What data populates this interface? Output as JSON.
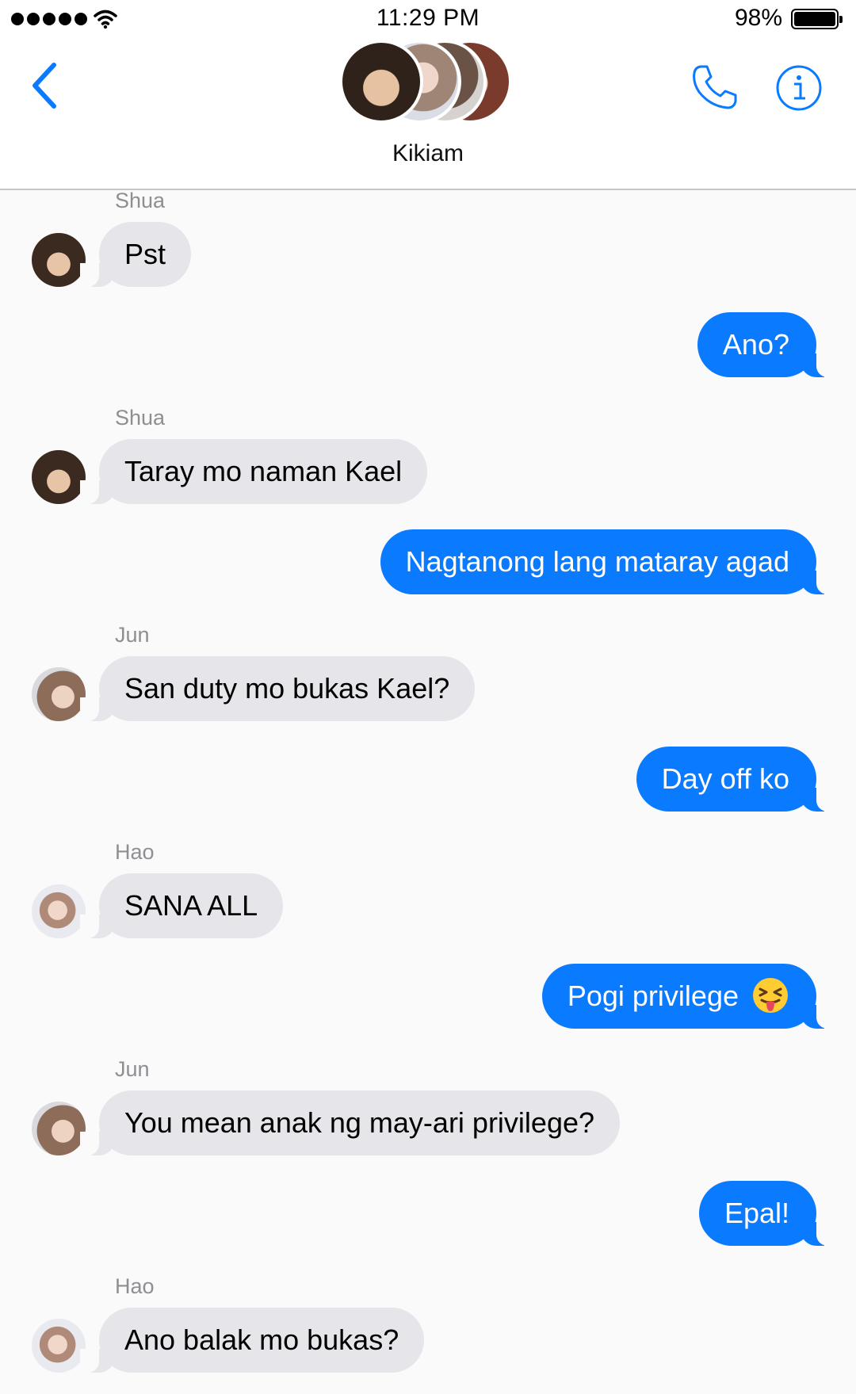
{
  "status_bar": {
    "time": "11:29 PM",
    "battery": "98%",
    "icons": [
      "signal-dots-icon",
      "wifi-icon",
      "battery-icon"
    ]
  },
  "header": {
    "group_name": "Kikiam",
    "icons": [
      "chevron-left-icon",
      "phone-icon",
      "info-icon"
    ],
    "accent_color": "#0a7aff"
  },
  "messages": [
    {
      "sender": "Shua",
      "text": "Pst",
      "direction": "incoming"
    },
    {
      "text": "Ano?",
      "direction": "outgoing"
    },
    {
      "sender": "Shua",
      "text": "Taray mo naman Kael",
      "direction": "incoming"
    },
    {
      "text": "Nagtanong lang mataray agad",
      "direction": "outgoing"
    },
    {
      "sender": "Jun",
      "text": "San duty mo bukas Kael?",
      "direction": "incoming"
    },
    {
      "text": "Day off ko",
      "direction": "outgoing"
    },
    {
      "sender": "Hao",
      "text": "SANA ALL",
      "direction": "incoming"
    },
    {
      "text": "Pogi privilege",
      "emoji": "squinting-face-with-tongue-icon",
      "direction": "outgoing"
    },
    {
      "sender": "Jun",
      "text": "You mean anak ng may-ari privilege?",
      "direction": "incoming"
    },
    {
      "text": "Epal!",
      "direction": "outgoing"
    },
    {
      "sender": "Hao",
      "text": "Ano balak mo bukas?",
      "direction": "incoming"
    }
  ],
  "colors": {
    "incoming_bubble": "#e5e5ea",
    "outgoing_bubble": "#0a7aff",
    "background": "#fafafa"
  }
}
